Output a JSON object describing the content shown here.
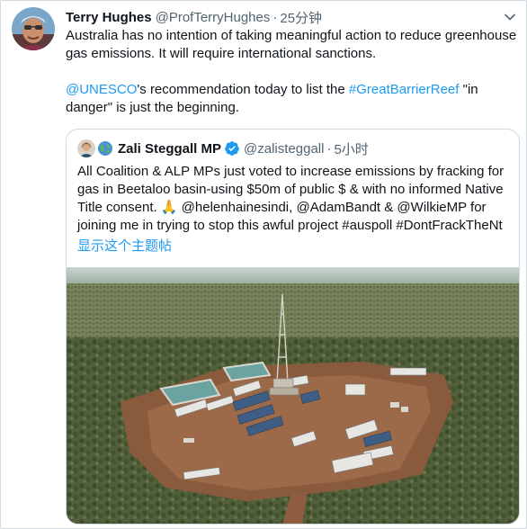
{
  "tweet": {
    "author_name": "Terry Hughes",
    "author_handle": "@ProfTerryHughes",
    "separator": "·",
    "time": "25分钟",
    "text_line1": "Australia has no intention of taking meaningful action to reduce greenhouse gas emissions. It will require international sanctions.",
    "mention_unesco": "@UNESCO",
    "text_part2": "'s recommendation today to list the ",
    "hashtag_gbr": "#GreatBarrierReef",
    "text_part3": " \"in danger\" is just the beginning.",
    "more_icon": "more-horizontal-icon"
  },
  "quoted_tweet": {
    "author_name": "Zali Steggall MP",
    "author_handle": "@zalisteggall",
    "separator": "·",
    "time": "5小时",
    "text_part1": "All Coalition & ALP MPs just voted to increase emissions by fracking for gas in Beetaloo basin-using $50m of public $ & with no informed Native Title consent. 🙏 @helenhainesindi, @AdamBandt & @WilkieMP for joining me in trying to stop this awful project #auspoll #DontFrackTheNt",
    "show_thread": "显示这个主题帖",
    "emoji_icon": "earth-globe-icon",
    "verified_icon": "verified-badge-icon",
    "image_alt": "aerial-photo-fracking-drill-site"
  },
  "colors": {
    "link": "#1d9bf0",
    "text": "#0f1419",
    "secondary": "#536471",
    "border": "#cfd9de"
  }
}
